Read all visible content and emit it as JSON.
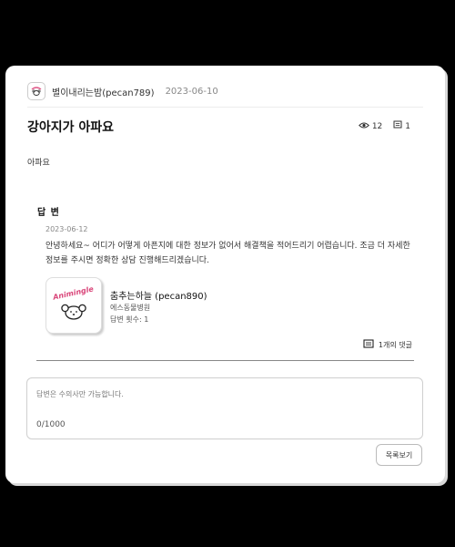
{
  "post": {
    "author": "별이내리는밤(pecan789)",
    "date": "2023-06-10",
    "title": "강아지가 아파요",
    "views": "12",
    "comments": "1",
    "body": "아파요"
  },
  "answer": {
    "heading": "답 변",
    "date": "2023-06-12",
    "text": "안녕하세요~ 어디가 어떻게 아픈지에 대한 정보가 없어서 해결책을 적어드리기 어렵습니다. 조금 더 자세한 정보를 주시면 정확한 상담 진행해드리겠습니다.",
    "answerer": {
      "name": "춤추는하늘 (pecan890)",
      "hospital": "에스동물병원",
      "answer_count": "답변 횟수: 1",
      "logo_text": "Animingle"
    },
    "comment_toggle": "1개의 댓글"
  },
  "reply": {
    "placeholder": "답변은 수의사만 가능합니다.",
    "counter": "0/1000"
  },
  "list_button": "목록보기",
  "colors": {
    "background": "#000000",
    "card": "#ffffff",
    "border": "#cfcfcf"
  },
  "icons": [
    "animingle-avatar-icon",
    "eye-icon",
    "comment-icon",
    "dog-logo-icon"
  ]
}
